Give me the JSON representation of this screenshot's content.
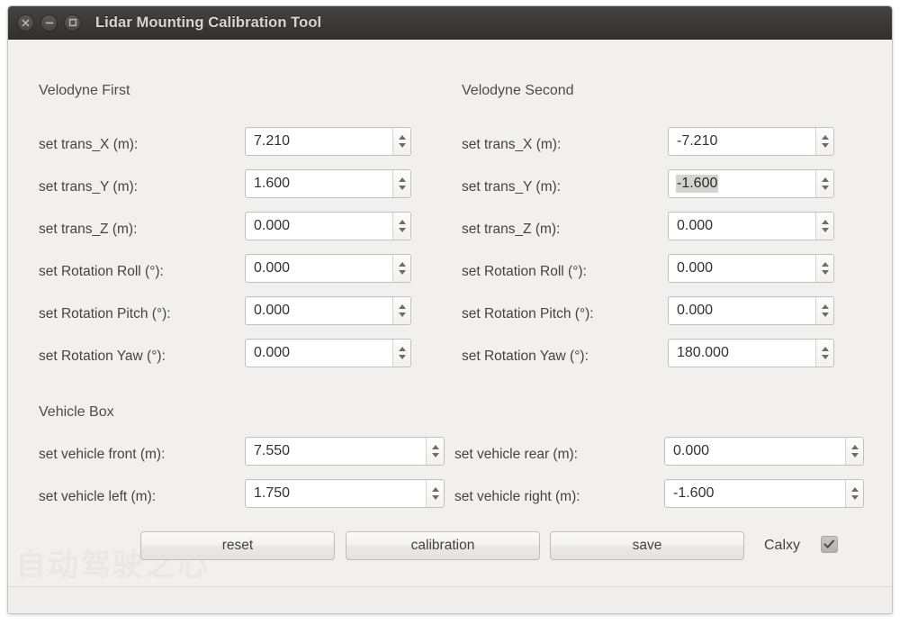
{
  "window": {
    "title": "Lidar Mounting Calibration Tool",
    "buttons": [
      {
        "name": "close",
        "glyph": "close-icon"
      },
      {
        "name": "minimize",
        "glyph": "minimize-icon"
      },
      {
        "name": "maximize",
        "glyph": "maximize-icon"
      }
    ]
  },
  "watermark": "自动驾驶之心",
  "sections": {
    "velodyne_first": {
      "title": "Velodyne First",
      "fields": [
        {
          "label": "set trans_X (m):",
          "value": "7.210",
          "selected": false
        },
        {
          "label": "set trans_Y (m):",
          "value": "1.600",
          "selected": false
        },
        {
          "label": "set trans_Z (m):",
          "value": "0.000",
          "selected": false
        },
        {
          "label": "set Rotation Roll (°):",
          "value": "0.000",
          "selected": false
        },
        {
          "label": "set Rotation Pitch (°):",
          "value": "0.000",
          "selected": false
        },
        {
          "label": "set Rotation Yaw (°):",
          "value": "0.000",
          "selected": false
        }
      ]
    },
    "velodyne_second": {
      "title": "Velodyne Second",
      "fields": [
        {
          "label": "set trans_X (m):",
          "value": "-7.210",
          "selected": false
        },
        {
          "label": "set trans_Y (m):",
          "value": "-1.600",
          "selected": true
        },
        {
          "label": "set trans_Z (m):",
          "value": "0.000",
          "selected": false
        },
        {
          "label": "set Rotation Roll (°):",
          "value": "0.000",
          "selected": false
        },
        {
          "label": "set Rotation Pitch (°):",
          "value": "0.000",
          "selected": false
        },
        {
          "label": "set Rotation Yaw (°):",
          "value": "180.000",
          "selected": false
        }
      ]
    },
    "vehicle_box": {
      "title": "Vehicle Box",
      "fields_left": [
        {
          "label": "set vehicle front (m):",
          "value": "7.550",
          "selected": false
        },
        {
          "label": "set vehicle left (m):",
          "value": "1.750",
          "selected": false
        }
      ],
      "fields_right": [
        {
          "label": "set vehicle rear (m):",
          "value": "0.000",
          "selected": false
        },
        {
          "label": "set vehicle right (m):",
          "value": "-1.600",
          "selected": false
        }
      ]
    }
  },
  "actions": {
    "reset_label": "reset",
    "calibration_label": "calibration",
    "save_label": "save",
    "calxy_label": "Calxy",
    "calxy_checked": true
  },
  "colors": {
    "titlebar": "#3c3a38",
    "window_bg": "#f1f0ee",
    "input_bg": "#ffffff",
    "text": "#46443f",
    "selection": "#d6d4d1"
  }
}
